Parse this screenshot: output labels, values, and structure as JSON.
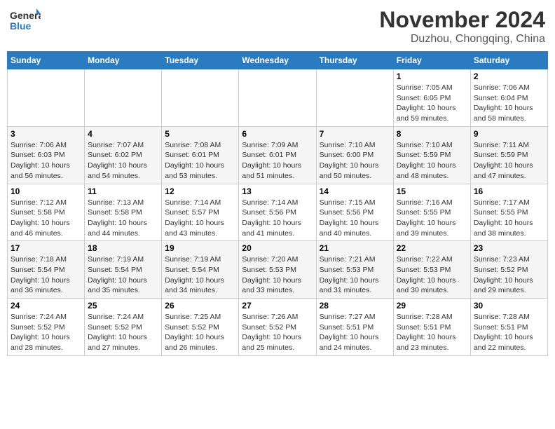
{
  "header": {
    "logo_general": "General",
    "logo_blue": "Blue",
    "month_year": "November 2024",
    "location": "Duzhou, Chongqing, China"
  },
  "days_of_week": [
    "Sunday",
    "Monday",
    "Tuesday",
    "Wednesday",
    "Thursday",
    "Friday",
    "Saturday"
  ],
  "weeks": [
    [
      {
        "day": "",
        "info": ""
      },
      {
        "day": "",
        "info": ""
      },
      {
        "day": "",
        "info": ""
      },
      {
        "day": "",
        "info": ""
      },
      {
        "day": "",
        "info": ""
      },
      {
        "day": "1",
        "info": "Sunrise: 7:05 AM\nSunset: 6:05 PM\nDaylight: 10 hours and 59 minutes."
      },
      {
        "day": "2",
        "info": "Sunrise: 7:06 AM\nSunset: 6:04 PM\nDaylight: 10 hours and 58 minutes."
      }
    ],
    [
      {
        "day": "3",
        "info": "Sunrise: 7:06 AM\nSunset: 6:03 PM\nDaylight: 10 hours and 56 minutes."
      },
      {
        "day": "4",
        "info": "Sunrise: 7:07 AM\nSunset: 6:02 PM\nDaylight: 10 hours and 54 minutes."
      },
      {
        "day": "5",
        "info": "Sunrise: 7:08 AM\nSunset: 6:01 PM\nDaylight: 10 hours and 53 minutes."
      },
      {
        "day": "6",
        "info": "Sunrise: 7:09 AM\nSunset: 6:01 PM\nDaylight: 10 hours and 51 minutes."
      },
      {
        "day": "7",
        "info": "Sunrise: 7:10 AM\nSunset: 6:00 PM\nDaylight: 10 hours and 50 minutes."
      },
      {
        "day": "8",
        "info": "Sunrise: 7:10 AM\nSunset: 5:59 PM\nDaylight: 10 hours and 48 minutes."
      },
      {
        "day": "9",
        "info": "Sunrise: 7:11 AM\nSunset: 5:59 PM\nDaylight: 10 hours and 47 minutes."
      }
    ],
    [
      {
        "day": "10",
        "info": "Sunrise: 7:12 AM\nSunset: 5:58 PM\nDaylight: 10 hours and 46 minutes."
      },
      {
        "day": "11",
        "info": "Sunrise: 7:13 AM\nSunset: 5:58 PM\nDaylight: 10 hours and 44 minutes."
      },
      {
        "day": "12",
        "info": "Sunrise: 7:14 AM\nSunset: 5:57 PM\nDaylight: 10 hours and 43 minutes."
      },
      {
        "day": "13",
        "info": "Sunrise: 7:14 AM\nSunset: 5:56 PM\nDaylight: 10 hours and 41 minutes."
      },
      {
        "day": "14",
        "info": "Sunrise: 7:15 AM\nSunset: 5:56 PM\nDaylight: 10 hours and 40 minutes."
      },
      {
        "day": "15",
        "info": "Sunrise: 7:16 AM\nSunset: 5:55 PM\nDaylight: 10 hours and 39 minutes."
      },
      {
        "day": "16",
        "info": "Sunrise: 7:17 AM\nSunset: 5:55 PM\nDaylight: 10 hours and 38 minutes."
      }
    ],
    [
      {
        "day": "17",
        "info": "Sunrise: 7:18 AM\nSunset: 5:54 PM\nDaylight: 10 hours and 36 minutes."
      },
      {
        "day": "18",
        "info": "Sunrise: 7:19 AM\nSunset: 5:54 PM\nDaylight: 10 hours and 35 minutes."
      },
      {
        "day": "19",
        "info": "Sunrise: 7:19 AM\nSunset: 5:54 PM\nDaylight: 10 hours and 34 minutes."
      },
      {
        "day": "20",
        "info": "Sunrise: 7:20 AM\nSunset: 5:53 PM\nDaylight: 10 hours and 33 minutes."
      },
      {
        "day": "21",
        "info": "Sunrise: 7:21 AM\nSunset: 5:53 PM\nDaylight: 10 hours and 31 minutes."
      },
      {
        "day": "22",
        "info": "Sunrise: 7:22 AM\nSunset: 5:53 PM\nDaylight: 10 hours and 30 minutes."
      },
      {
        "day": "23",
        "info": "Sunrise: 7:23 AM\nSunset: 5:52 PM\nDaylight: 10 hours and 29 minutes."
      }
    ],
    [
      {
        "day": "24",
        "info": "Sunrise: 7:24 AM\nSunset: 5:52 PM\nDaylight: 10 hours and 28 minutes."
      },
      {
        "day": "25",
        "info": "Sunrise: 7:24 AM\nSunset: 5:52 PM\nDaylight: 10 hours and 27 minutes."
      },
      {
        "day": "26",
        "info": "Sunrise: 7:25 AM\nSunset: 5:52 PM\nDaylight: 10 hours and 26 minutes."
      },
      {
        "day": "27",
        "info": "Sunrise: 7:26 AM\nSunset: 5:52 PM\nDaylight: 10 hours and 25 minutes."
      },
      {
        "day": "28",
        "info": "Sunrise: 7:27 AM\nSunset: 5:51 PM\nDaylight: 10 hours and 24 minutes."
      },
      {
        "day": "29",
        "info": "Sunrise: 7:28 AM\nSunset: 5:51 PM\nDaylight: 10 hours and 23 minutes."
      },
      {
        "day": "30",
        "info": "Sunrise: 7:28 AM\nSunset: 5:51 PM\nDaylight: 10 hours and 22 minutes."
      }
    ]
  ]
}
